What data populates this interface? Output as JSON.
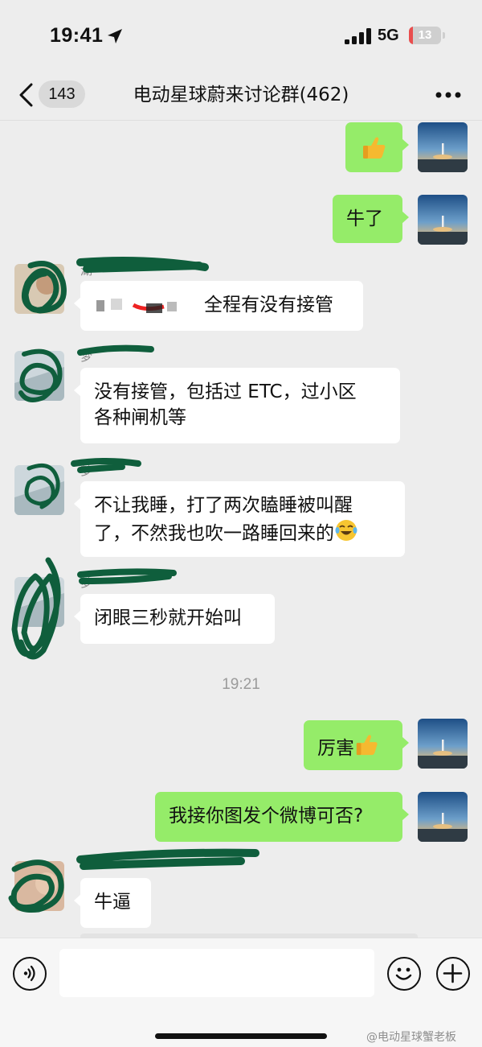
{
  "status_bar": {
    "time": "19:41",
    "network": "5G",
    "battery_level": "13",
    "battery_fraction": 0.13,
    "icons": [
      "location-arrow-icon",
      "signal-bars-icon",
      "battery-icon"
    ]
  },
  "nav": {
    "unread_count": "143",
    "title": "电动星球蔚来讨论群(462)",
    "icons": [
      "chevron-left-icon",
      "more-dots-icon"
    ]
  },
  "messages": [
    {
      "side": "out",
      "type": "emoji",
      "emoji_name": "thumbs-up-icon"
    },
    {
      "side": "out",
      "text": "牛了"
    },
    {
      "side": "in",
      "sender_visible": "湖",
      "text": "全程有没有接管",
      "note_redacted": true
    },
    {
      "side": "in",
      "sender_visible": "梦",
      "text_line1": "没有接管，包括过 ETC，过小区",
      "text_line2": "各种闸机等"
    },
    {
      "side": "in",
      "sender_visible": "梦",
      "text_line1": "不让我睡，打了两次瞌睡被叫醒",
      "text_line2": "了，不然我也吹一路睡回来的",
      "emoji_name": "laughing-tears-icon"
    },
    {
      "side": "in",
      "sender_visible": "梦",
      "text": "闭眼三秒就开始叫"
    },
    {
      "time": "19:21"
    },
    {
      "side": "out",
      "text": "厉害",
      "emoji_name": "thumbs-up-icon"
    },
    {
      "side": "out",
      "text": "我接你图发个微博可否?"
    },
    {
      "side": "in",
      "text": "牛逼"
    }
  ],
  "input_bar": {
    "placeholder": "",
    "icons": [
      "voice-icon",
      "emoji-face-icon",
      "plus-icon"
    ]
  },
  "watermark": "@电动星球蟹老板",
  "colors": {
    "background": "#ededed",
    "outgoing_bubble": "#95ec69",
    "incoming_bubble": "#ffffff",
    "scribble": "#0f5e3c",
    "battery_low": "#e94e4e"
  }
}
